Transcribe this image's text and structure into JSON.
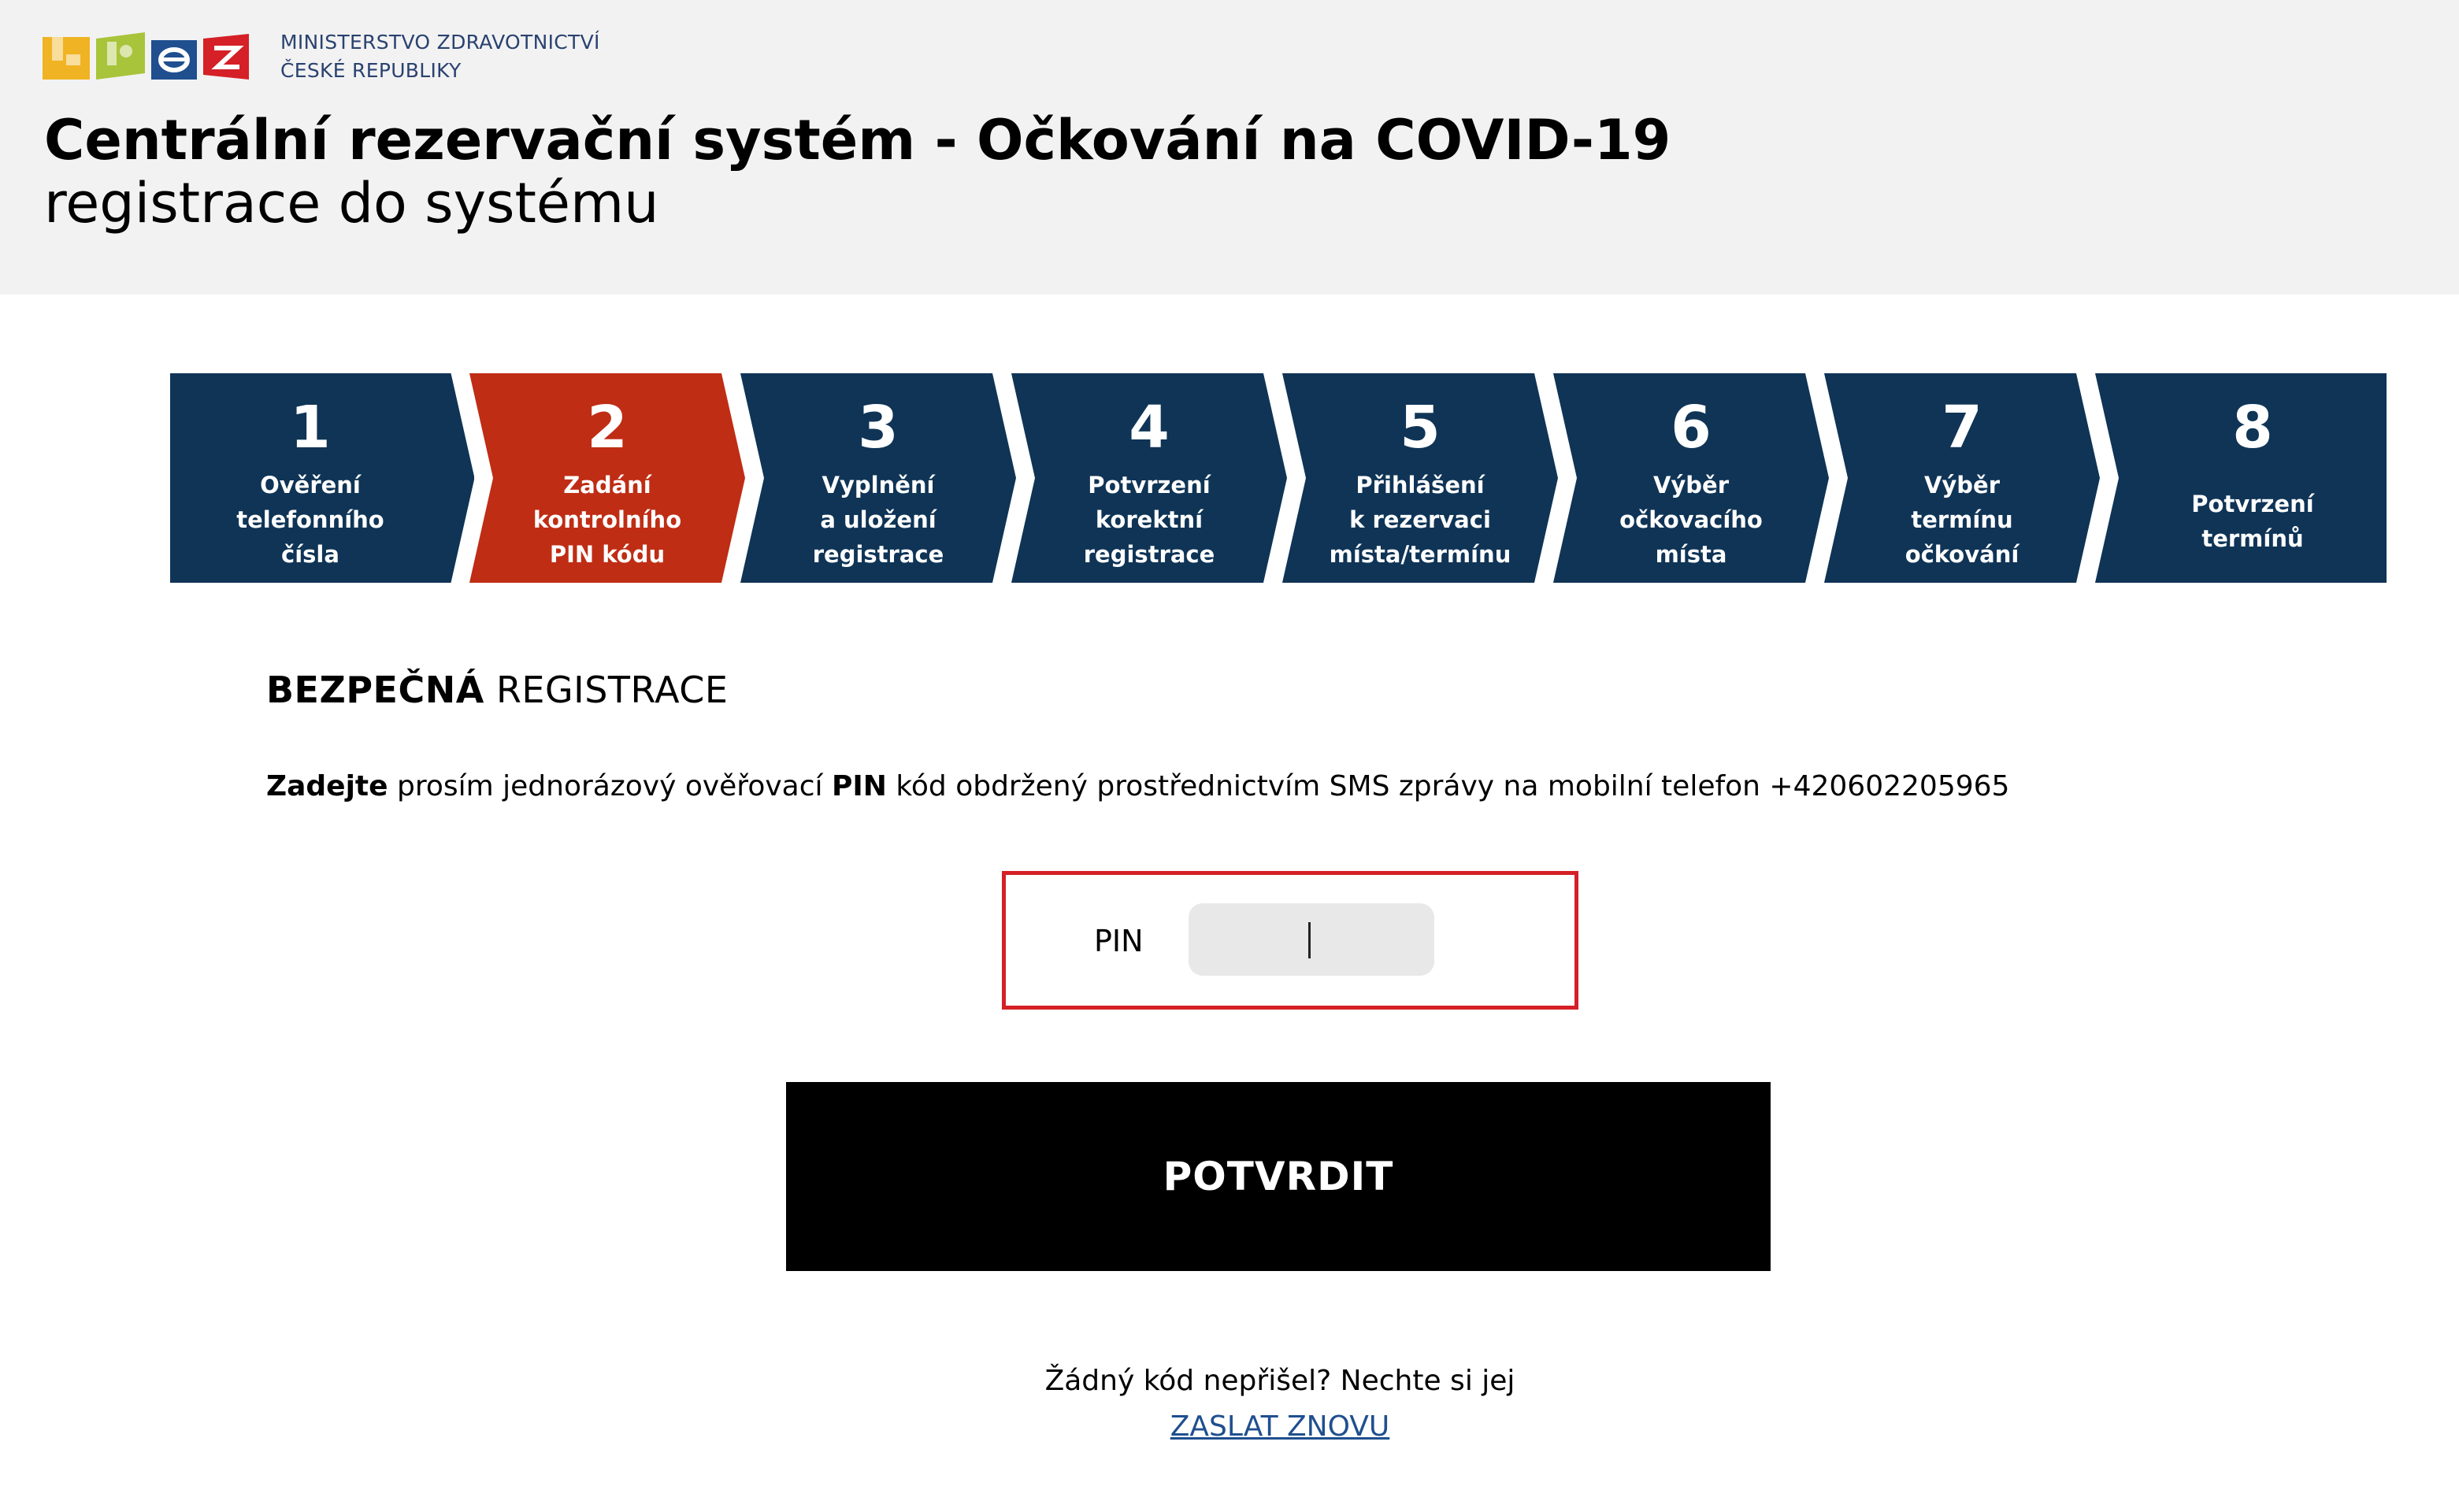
{
  "header": {
    "ministry_line1": "MINISTERSTVO ZDRAVOTNICTVÍ",
    "ministry_line2": "ČESKÉ REPUBLIKY",
    "title": "Centrální rezervační systém - Očkování na COVID-19",
    "subtitle": "registrace do systému",
    "logo_colors": [
      "#f0b323",
      "#a8c43a",
      "#1f4f8f",
      "#d42026"
    ]
  },
  "stepper": {
    "active_step": 2,
    "colors": {
      "default": "#0f3456",
      "active": "#bf2d14",
      "text": "#ffffff"
    },
    "steps": [
      {
        "number": "1",
        "label": "Ověření\ntelefonního\nčísla"
      },
      {
        "number": "2",
        "label": "Zadání\nkontrolního\nPIN kódu"
      },
      {
        "number": "3",
        "label": "Vyplnění\na uložení\nregistrace"
      },
      {
        "number": "4",
        "label": "Potvrzení\nkorektní\nregistrace"
      },
      {
        "number": "5",
        "label": "Přihlášení\nk rezervaci\nmísta/termínu"
      },
      {
        "number": "6",
        "label": "Výběr\nočkovacího\nmísta"
      },
      {
        "number": "7",
        "label": "Výběr\ntermínu\nočkování"
      },
      {
        "number": "8",
        "label": "Potvrzení\ntermínů"
      }
    ]
  },
  "main": {
    "section_title_bold": "BEZPEČNÁ",
    "section_title_rest": " REGISTRACE",
    "instruction": {
      "part1_bold": "Zadejte",
      "part2": " prosím jednorázový ověřovací ",
      "part3_bold": "PIN",
      "part4": " kód obdržený prostřednictvím SMS zprávy na mobilní telefon +420602205965"
    },
    "pin": {
      "label": "PIN",
      "value": "",
      "border_color": "#d42026"
    },
    "confirm_button": "POTVRDIT",
    "resend_text": "Žádný kód nepřišel? Nechte si jej",
    "resend_link": "ZASLAT ZNOVU"
  }
}
